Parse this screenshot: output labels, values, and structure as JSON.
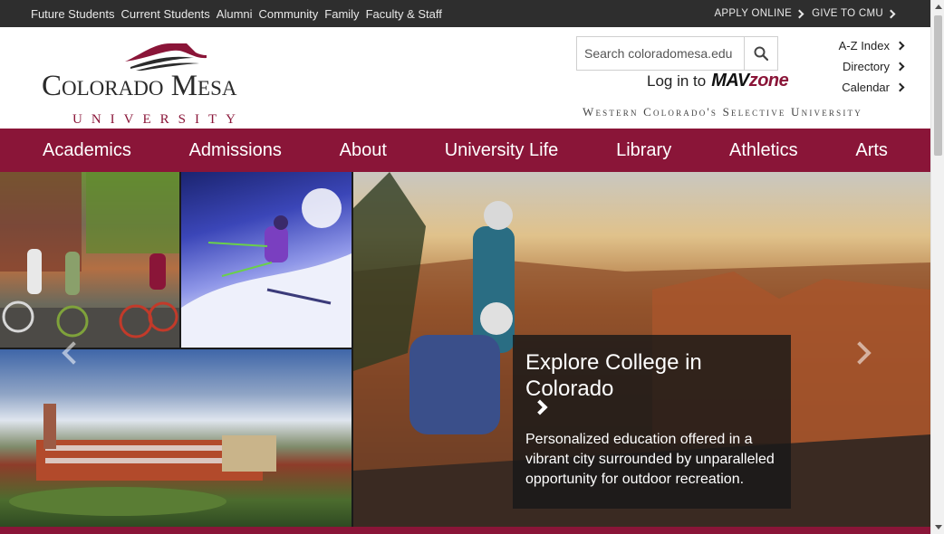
{
  "colors": {
    "brand": "#8a1538",
    "topbar": "#2e2e2e",
    "text": "#222222"
  },
  "topbar": {
    "audiences": [
      "Future Students",
      "Current Students",
      "Alumni",
      "Community",
      "Family",
      "Faculty & Staff"
    ],
    "apply_label": "APPLY ONLINE",
    "give_label": "GIVE TO CMU"
  },
  "logo": {
    "name": "Colorado Mesa",
    "sub": "UNIVERSITY"
  },
  "search": {
    "placeholder": "Search coloradomesa.edu",
    "icon": "search-icon"
  },
  "login": {
    "prefix": "Log in to",
    "brand_part1": "MAV",
    "brand_part2": "zone"
  },
  "tagline": "Western Colorado's Selective University",
  "quicklinks": [
    "A-Z Index",
    "Directory",
    "Calendar"
  ],
  "nav": [
    "Academics",
    "Admissions",
    "About",
    "University Life",
    "Library",
    "Athletics",
    "Arts"
  ],
  "carousel": {
    "caption_title": "Explore College in Colorado",
    "caption_body": "Personalized education offered in a vibrant city surrounded by unparalleled opportunity for outdoor recreation."
  }
}
